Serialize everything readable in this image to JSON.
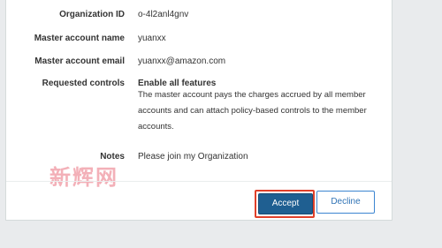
{
  "details": {
    "organization_id_label": "Organization ID",
    "organization_id_value": "o-4l2anl4gnv",
    "master_name_label": "Master account name",
    "master_name_value": "yuanxx",
    "master_email_label": "Master account email",
    "master_email_value": "yuanxx@amazon.com",
    "requested_controls_label": "Requested controls",
    "requested_controls_value": "Enable all features",
    "requested_controls_desc": "The master account pays the charges accrued by all member accounts and can attach policy-based controls to the member accounts.",
    "notes_label": "Notes",
    "notes_value": "Please join my Organization"
  },
  "watermark": {
    "text": "新辉网"
  },
  "footer": {
    "accept_label": "Accept",
    "decline_label": "Decline"
  },
  "colors": {
    "accept_bg": "#1f5f91",
    "highlight": "#e0402a",
    "decline_border": "#3b85d1"
  }
}
